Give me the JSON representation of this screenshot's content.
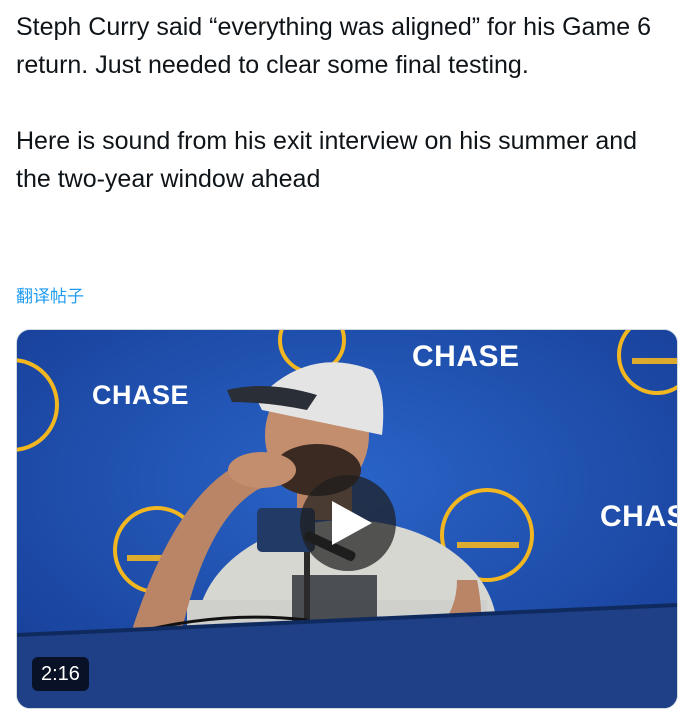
{
  "tweet": {
    "text_line1": "Steph Curry said “everything was aligned” for his Game 6 return. Just needed to clear some final testing.",
    "text_line2": "Here is sound from his exit interview on his summer and the two-year window ahead",
    "translate_label": "翻译帖子"
  },
  "video": {
    "duration": "2:16",
    "backdrop_sponsor": "CHASE",
    "colors": {
      "backdrop": "#1d4fb0",
      "gold": "#f2b621",
      "table": "#1f3f86"
    }
  }
}
